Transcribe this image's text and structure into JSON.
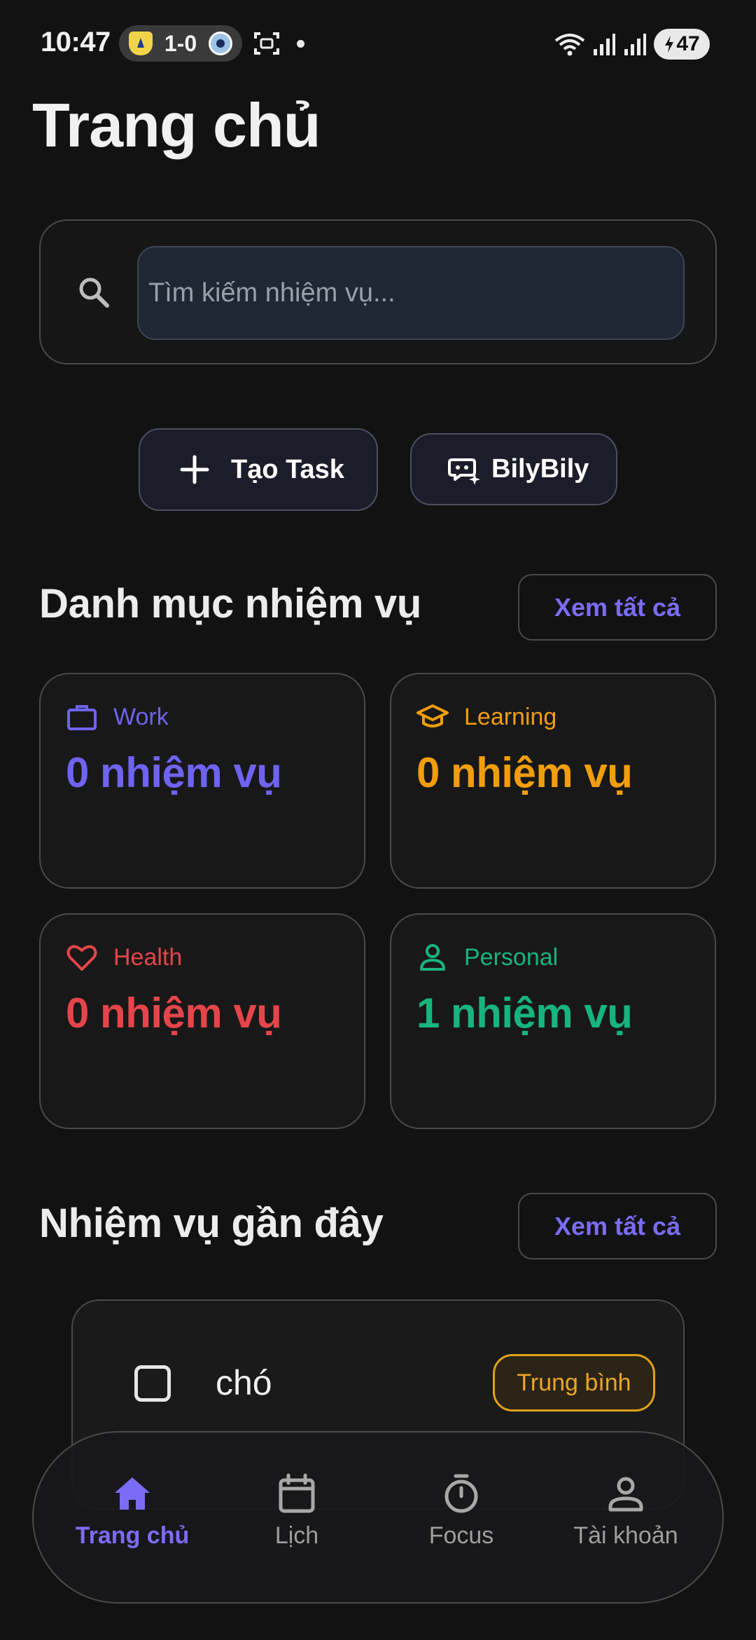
{
  "status_bar": {
    "time": "10:47",
    "score": "1-0",
    "battery": "47",
    "icons": [
      "team-crest-icon",
      "team-crest-icon",
      "screenshot-icon",
      "notification-dot",
      "wifi-icon",
      "signal-icon",
      "signal-icon",
      "battery-charging-icon"
    ]
  },
  "header": {
    "title": "Trang chủ"
  },
  "search": {
    "placeholder": "Tìm kiếm nhiệm vụ...",
    "value": "",
    "icon": "search-icon"
  },
  "actions": {
    "create_label": "Tạo Task",
    "create_icon": "plus-icon",
    "bily_label": "BilyBily",
    "bily_icon": "chatbot-icon"
  },
  "categories_section": {
    "title": "Danh mục nhiệm vụ",
    "see_all": "Xem tất cả",
    "items": [
      {
        "name": "Work",
        "count": "0 nhiệm vụ",
        "color": "#6F63F2",
        "icon": "briefcase-icon"
      },
      {
        "name": "Learning",
        "count": "0 nhiệm vụ",
        "color": "#F29E0C",
        "icon": "graduation-cap-icon"
      },
      {
        "name": "Health",
        "count": "0 nhiệm vụ",
        "color": "#E5454A",
        "icon": "heart-icon"
      },
      {
        "name": "Personal",
        "count": "1 nhiệm vụ",
        "color": "#17B57E",
        "icon": "person-icon"
      }
    ]
  },
  "recent_section": {
    "title": "Nhiệm vụ gần đây",
    "see_all": "Xem tất cả",
    "tasks": [
      {
        "title": "chó",
        "priority": "Trung bình",
        "priority_color": "#E0A11B",
        "completed": false
      }
    ]
  },
  "bottom_nav": {
    "accent": "#7B6CF6",
    "items": [
      {
        "label": "Trang chủ",
        "icon": "home-icon",
        "active": true
      },
      {
        "label": "Lịch",
        "icon": "calendar-icon",
        "active": false
      },
      {
        "label": "Focus",
        "icon": "timer-icon",
        "active": false
      },
      {
        "label": "Tài khoản",
        "icon": "account-icon",
        "active": false
      }
    ]
  }
}
